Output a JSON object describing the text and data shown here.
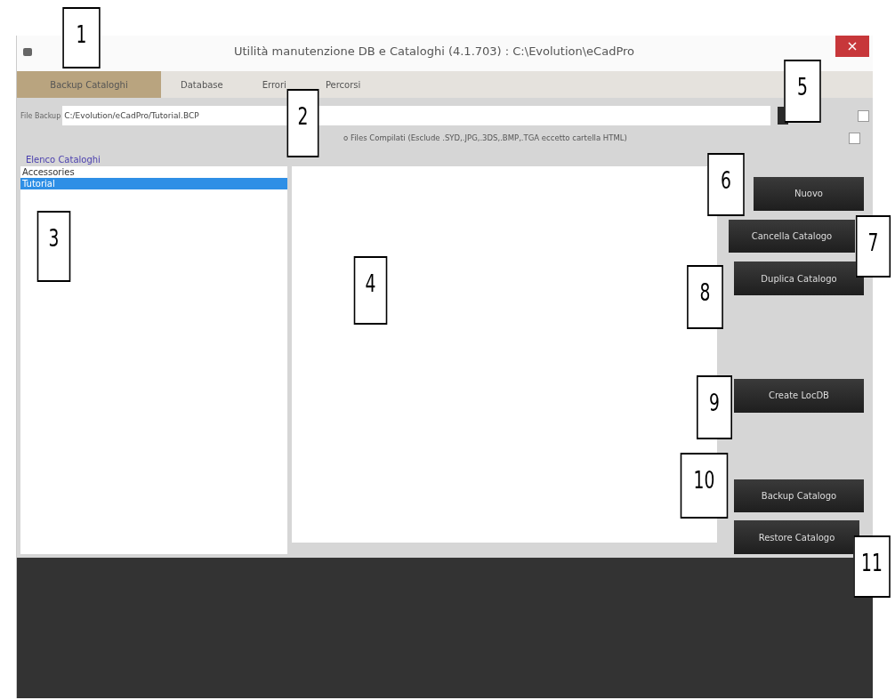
{
  "window": {
    "title": "Utilità manutenzione DB e Cataloghi  (4.1.703) : C:\\Evolution\\eCadPro"
  },
  "tabs": [
    {
      "label": "Backup Cataloghi",
      "selected": true
    },
    {
      "label": "Database",
      "selected": false
    },
    {
      "label": "Errori",
      "selected": false
    },
    {
      "label": "Percorsi",
      "selected": false
    }
  ],
  "file_backup": {
    "label": "File Backup",
    "value": "C:/Evolution/eCadPro/Tutorial.BCP",
    "checked": false
  },
  "compiled_files": {
    "label": "o Files Compilati (Esclude .SYD,.JPG,.3DS,.BMP,.TGA eccetto cartella HTML)",
    "checked": false
  },
  "catalog_list": {
    "title": "Elenco Cataloghi",
    "items": [
      {
        "label": "Accessories",
        "selected": false
      },
      {
        "label": "Tutorial",
        "selected": true
      }
    ]
  },
  "buttons": [
    "Nuovo",
    "Cancella Catalogo",
    "Duplica Catalogo",
    "Create LocDB",
    "Backup Catalogo",
    "Restore Catalogo"
  ],
  "callouts": [
    "1",
    "2",
    "3",
    "4",
    "5",
    "6",
    "7",
    "8",
    "9",
    "10",
    "11"
  ]
}
